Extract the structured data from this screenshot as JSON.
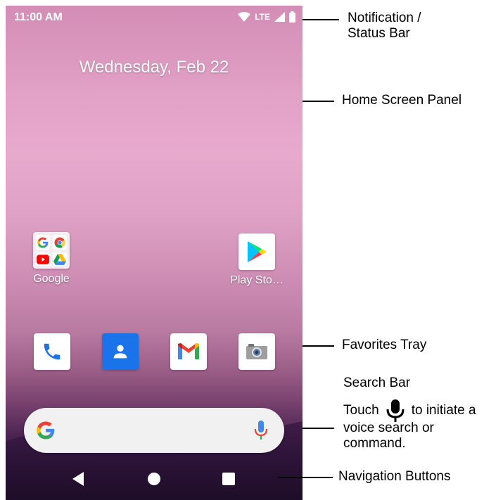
{
  "status_bar": {
    "time": "11:00 AM",
    "network": "LTE",
    "icons": [
      "wifi-icon",
      "signal-icon",
      "battery-icon"
    ]
  },
  "home": {
    "date": "Wednesday, Feb 22"
  },
  "apps": {
    "google_folder_label": "Google",
    "play_store_label": "Play Sto…",
    "folder_icons": [
      "google-icon",
      "chrome-icon",
      "youtube-icon",
      "drive-icon"
    ]
  },
  "favorites": [
    "phone-icon",
    "contacts-icon",
    "gmail-icon",
    "camera-icon"
  ],
  "search_bar": {
    "icons": [
      "google-g-icon",
      "mic-icon"
    ]
  },
  "navigation": {
    "buttons": [
      "back",
      "home",
      "recents"
    ]
  },
  "callouts": {
    "notification_line1": "Notification /",
    "notification_line2": "Status Bar",
    "home_panel": "Home Screen Panel",
    "favorites_tray": "Favorites Tray",
    "search_title": "Search Bar",
    "search_touch": "Touch",
    "search_initiate": "to initiate a",
    "search_line3": "voice search or",
    "search_line4": "command.",
    "nav_buttons": "Navigation Buttons"
  },
  "colors": {
    "accent_blue": "#4285F4",
    "red": "#EA4335",
    "yellow": "#FBBC05",
    "green": "#34A853"
  }
}
